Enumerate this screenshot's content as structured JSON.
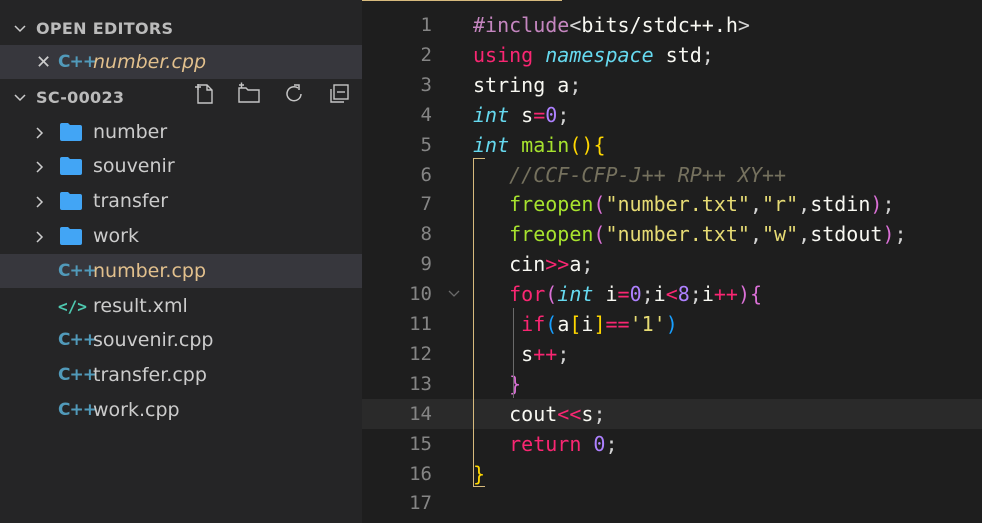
{
  "sidebar": {
    "open_editors_header": "OPEN EDITORS",
    "open_editors": [
      {
        "close": "✕",
        "icon": "C++",
        "label": "number.cpp"
      }
    ],
    "project_header": "SC-00023",
    "toolbar": [
      "new-file-icon",
      "new-folder-icon",
      "refresh-icon",
      "collapse-all-icon"
    ],
    "folders": [
      "number",
      "souvenir",
      "transfer",
      "work"
    ],
    "files": [
      {
        "icon": "C++",
        "label": "number.cpp"
      },
      {
        "icon": "</>",
        "label": "result.xml"
      },
      {
        "icon": "C++",
        "label": "souvenir.cpp"
      },
      {
        "icon": "C++",
        "label": "transfer.cpp"
      },
      {
        "icon": "C++",
        "label": "work.cpp"
      }
    ]
  },
  "editor": {
    "line_numbers": [
      "1",
      "2",
      "3",
      "4",
      "5",
      "6",
      "7",
      "8",
      "9",
      "10",
      "11",
      "12",
      "13",
      "14",
      "15",
      "16",
      "17"
    ],
    "lines": [
      [
        [
          "pre",
          "#include"
        ],
        [
          "punc",
          "<"
        ],
        [
          "plain",
          "bits/stdc++.h"
        ],
        [
          "punc",
          ">"
        ]
      ],
      [
        [
          "kw",
          "using "
        ],
        [
          "kw2",
          "namespace"
        ],
        [
          "plain",
          " std"
        ],
        [
          "punc",
          ";"
        ]
      ],
      [
        [
          "plain",
          "string a"
        ],
        [
          "punc",
          ";"
        ]
      ],
      [
        [
          "type",
          "int"
        ],
        [
          "plain",
          " s"
        ],
        [
          "op",
          "="
        ],
        [
          "num",
          "0"
        ],
        [
          "punc",
          ";"
        ]
      ],
      [
        [
          "type",
          "int"
        ],
        [
          "plain",
          " "
        ],
        [
          "fn",
          "main"
        ],
        [
          "brk1",
          "()"
        ],
        [
          "brk1",
          "{"
        ]
      ],
      [
        [
          "plain",
          "   "
        ],
        [
          "com",
          "//CCF-CFP-J++ RP++ XY++"
        ]
      ],
      [
        [
          "plain",
          "   "
        ],
        [
          "fn",
          "freopen"
        ],
        [
          "brk2",
          "("
        ],
        [
          "str",
          "\"number.txt\""
        ],
        [
          "punc",
          ","
        ],
        [
          "str",
          "\"r\""
        ],
        [
          "punc",
          ","
        ],
        [
          "plain",
          "stdin"
        ],
        [
          "brk2",
          ")"
        ],
        [
          "punc",
          ";"
        ]
      ],
      [
        [
          "plain",
          "   "
        ],
        [
          "fn",
          "freopen"
        ],
        [
          "brk2",
          "("
        ],
        [
          "str",
          "\"number.txt\""
        ],
        [
          "punc",
          ","
        ],
        [
          "str",
          "\"w\""
        ],
        [
          "punc",
          ","
        ],
        [
          "plain",
          "stdout"
        ],
        [
          "brk2",
          ")"
        ],
        [
          "punc",
          ";"
        ]
      ],
      [
        [
          "plain",
          "   cin"
        ],
        [
          "op",
          ">>"
        ],
        [
          "plain",
          "a"
        ],
        [
          "punc",
          ";"
        ]
      ],
      [
        [
          "plain",
          "   "
        ],
        [
          "kw",
          "for"
        ],
        [
          "brk2",
          "("
        ],
        [
          "type",
          "int"
        ],
        [
          "plain",
          " i"
        ],
        [
          "op",
          "="
        ],
        [
          "num",
          "0"
        ],
        [
          "punc",
          ";"
        ],
        [
          "plain",
          "i"
        ],
        [
          "op",
          "<"
        ],
        [
          "num",
          "8"
        ],
        [
          "punc",
          ";"
        ],
        [
          "plain",
          "i"
        ],
        [
          "op",
          "++"
        ],
        [
          "brk2",
          ")"
        ],
        [
          "brk2",
          "{"
        ]
      ],
      [
        [
          "plain",
          "    "
        ],
        [
          "kw",
          "if"
        ],
        [
          "brk3",
          "("
        ],
        [
          "plain",
          "a"
        ],
        [
          "brk1",
          "["
        ],
        [
          "plain",
          "i"
        ],
        [
          "brk1",
          "]"
        ],
        [
          "op",
          "=="
        ],
        [
          "str",
          "'1'"
        ],
        [
          "brk3",
          ")"
        ]
      ],
      [
        [
          "plain",
          "    s"
        ],
        [
          "op",
          "++"
        ],
        [
          "punc",
          ";"
        ]
      ],
      [
        [
          "plain",
          "   "
        ],
        [
          "brk2",
          "}"
        ]
      ],
      [
        [
          "plain",
          "   cout"
        ],
        [
          "op",
          "<<"
        ],
        [
          "plain",
          "s"
        ],
        [
          "punc",
          ";"
        ]
      ],
      [
        [
          "plain",
          "   "
        ],
        [
          "kw",
          "return"
        ],
        [
          "plain",
          " "
        ],
        [
          "num",
          "0"
        ],
        [
          "punc",
          ";"
        ]
      ],
      [
        [
          "brk1",
          "}"
        ]
      ],
      []
    ],
    "current_line_index": 13,
    "fold_line_index": 9
  },
  "colors": {
    "accent_yellow": "#e2c08d",
    "cpp_icon": "#519aba",
    "folder_icon": "#42a5f5"
  }
}
